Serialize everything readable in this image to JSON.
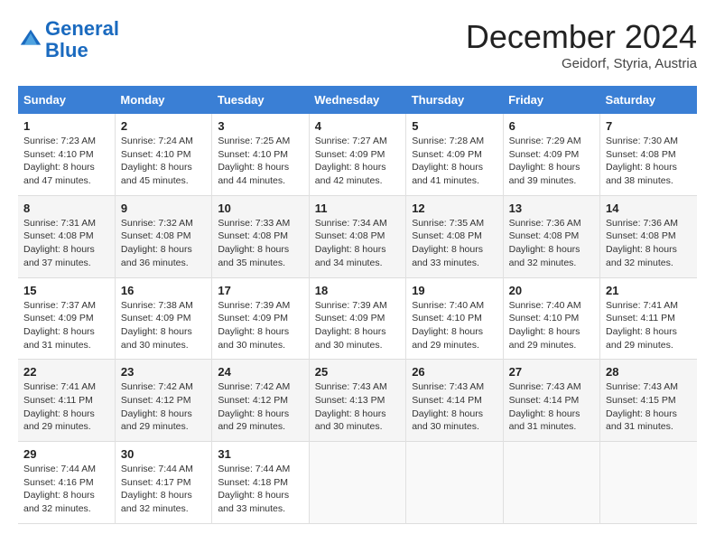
{
  "header": {
    "logo_line1": "General",
    "logo_line2": "Blue",
    "month": "December 2024",
    "location": "Geidorf, Styria, Austria"
  },
  "weekdays": [
    "Sunday",
    "Monday",
    "Tuesday",
    "Wednesday",
    "Thursday",
    "Friday",
    "Saturday"
  ],
  "weeks": [
    [
      {
        "day": "1",
        "sunrise": "7:23 AM",
        "sunset": "4:10 PM",
        "daylight": "8 hours and 47 minutes."
      },
      {
        "day": "2",
        "sunrise": "7:24 AM",
        "sunset": "4:10 PM",
        "daylight": "8 hours and 45 minutes."
      },
      {
        "day": "3",
        "sunrise": "7:25 AM",
        "sunset": "4:10 PM",
        "daylight": "8 hours and 44 minutes."
      },
      {
        "day": "4",
        "sunrise": "7:27 AM",
        "sunset": "4:09 PM",
        "daylight": "8 hours and 42 minutes."
      },
      {
        "day": "5",
        "sunrise": "7:28 AM",
        "sunset": "4:09 PM",
        "daylight": "8 hours and 41 minutes."
      },
      {
        "day": "6",
        "sunrise": "7:29 AM",
        "sunset": "4:09 PM",
        "daylight": "8 hours and 39 minutes."
      },
      {
        "day": "7",
        "sunrise": "7:30 AM",
        "sunset": "4:08 PM",
        "daylight": "8 hours and 38 minutes."
      }
    ],
    [
      {
        "day": "8",
        "sunrise": "7:31 AM",
        "sunset": "4:08 PM",
        "daylight": "8 hours and 37 minutes."
      },
      {
        "day": "9",
        "sunrise": "7:32 AM",
        "sunset": "4:08 PM",
        "daylight": "8 hours and 36 minutes."
      },
      {
        "day": "10",
        "sunrise": "7:33 AM",
        "sunset": "4:08 PM",
        "daylight": "8 hours and 35 minutes."
      },
      {
        "day": "11",
        "sunrise": "7:34 AM",
        "sunset": "4:08 PM",
        "daylight": "8 hours and 34 minutes."
      },
      {
        "day": "12",
        "sunrise": "7:35 AM",
        "sunset": "4:08 PM",
        "daylight": "8 hours and 33 minutes."
      },
      {
        "day": "13",
        "sunrise": "7:36 AM",
        "sunset": "4:08 PM",
        "daylight": "8 hours and 32 minutes."
      },
      {
        "day": "14",
        "sunrise": "7:36 AM",
        "sunset": "4:08 PM",
        "daylight": "8 hours and 32 minutes."
      }
    ],
    [
      {
        "day": "15",
        "sunrise": "7:37 AM",
        "sunset": "4:09 PM",
        "daylight": "8 hours and 31 minutes."
      },
      {
        "day": "16",
        "sunrise": "7:38 AM",
        "sunset": "4:09 PM",
        "daylight": "8 hours and 30 minutes."
      },
      {
        "day": "17",
        "sunrise": "7:39 AM",
        "sunset": "4:09 PM",
        "daylight": "8 hours and 30 minutes."
      },
      {
        "day": "18",
        "sunrise": "7:39 AM",
        "sunset": "4:09 PM",
        "daylight": "8 hours and 30 minutes."
      },
      {
        "day": "19",
        "sunrise": "7:40 AM",
        "sunset": "4:10 PM",
        "daylight": "8 hours and 29 minutes."
      },
      {
        "day": "20",
        "sunrise": "7:40 AM",
        "sunset": "4:10 PM",
        "daylight": "8 hours and 29 minutes."
      },
      {
        "day": "21",
        "sunrise": "7:41 AM",
        "sunset": "4:11 PM",
        "daylight": "8 hours and 29 minutes."
      }
    ],
    [
      {
        "day": "22",
        "sunrise": "7:41 AM",
        "sunset": "4:11 PM",
        "daylight": "8 hours and 29 minutes."
      },
      {
        "day": "23",
        "sunrise": "7:42 AM",
        "sunset": "4:12 PM",
        "daylight": "8 hours and 29 minutes."
      },
      {
        "day": "24",
        "sunrise": "7:42 AM",
        "sunset": "4:12 PM",
        "daylight": "8 hours and 29 minutes."
      },
      {
        "day": "25",
        "sunrise": "7:43 AM",
        "sunset": "4:13 PM",
        "daylight": "8 hours and 30 minutes."
      },
      {
        "day": "26",
        "sunrise": "7:43 AM",
        "sunset": "4:14 PM",
        "daylight": "8 hours and 30 minutes."
      },
      {
        "day": "27",
        "sunrise": "7:43 AM",
        "sunset": "4:14 PM",
        "daylight": "8 hours and 31 minutes."
      },
      {
        "day": "28",
        "sunrise": "7:43 AM",
        "sunset": "4:15 PM",
        "daylight": "8 hours and 31 minutes."
      }
    ],
    [
      {
        "day": "29",
        "sunrise": "7:44 AM",
        "sunset": "4:16 PM",
        "daylight": "8 hours and 32 minutes."
      },
      {
        "day": "30",
        "sunrise": "7:44 AM",
        "sunset": "4:17 PM",
        "daylight": "8 hours and 32 minutes."
      },
      {
        "day": "31",
        "sunrise": "7:44 AM",
        "sunset": "4:18 PM",
        "daylight": "8 hours and 33 minutes."
      },
      null,
      null,
      null,
      null
    ]
  ]
}
